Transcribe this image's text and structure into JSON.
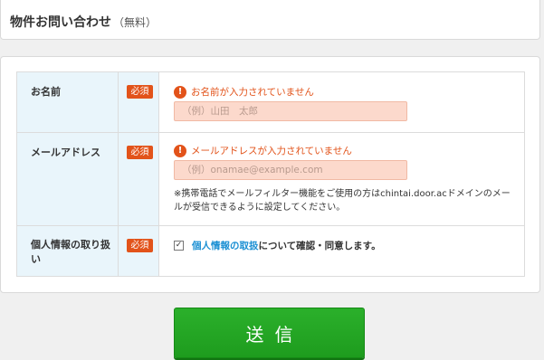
{
  "header": {
    "title": "物件お問い合わせ",
    "subtitle": "（無料）"
  },
  "form": {
    "rows": [
      {
        "label": "お名前",
        "required": "必須",
        "error": "お名前が入力されていません",
        "placeholder": "（例）山田　太郎"
      },
      {
        "label": "メールアドレス",
        "required": "必須",
        "error": "メールアドレスが入力されていません",
        "placeholder": "（例）onamae@example.com",
        "note": "※携帯電話でメールフィルター機能をご使用の方はchintai.door.acドメインのメールが受信できるように設定してください。"
      },
      {
        "label": "個人情報の取り扱い",
        "required": "必須",
        "checkbox_mark": "✓",
        "agree_link": "個人情報の取扱",
        "agree_text": "について確認・同意します。"
      }
    ],
    "error_icon": "!"
  },
  "submit": {
    "label": "送信"
  },
  "colors": {
    "accent": "#e2531a",
    "label_bg": "#e9f5fb",
    "submit": "#1e9c1e",
    "link": "#1a8fd3"
  }
}
